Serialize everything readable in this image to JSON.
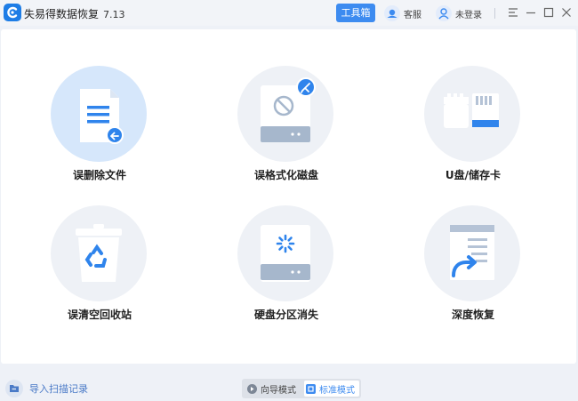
{
  "titlebar": {
    "app_name": "失易得数据恢复",
    "version": "7.13",
    "toolbox_label": "工具箱",
    "service_label": "客服",
    "login_label": "未登录"
  },
  "recovery_options": [
    {
      "label": "误删除文件",
      "icon": "deleted-file-icon"
    },
    {
      "label": "误格式化磁盘",
      "icon": "formatted-disk-icon"
    },
    {
      "label": "U盘/储存卡",
      "icon": "usb-card-icon"
    },
    {
      "label": "误清空回收站",
      "icon": "recycle-bin-icon"
    },
    {
      "label": "硬盘分区消失",
      "icon": "lost-partition-icon"
    },
    {
      "label": "深度恢复",
      "icon": "deep-recovery-icon"
    }
  ],
  "footer": {
    "import_label": "导入扫描记录",
    "guide_mode_label": "向导模式",
    "standard_mode_label": "标准模式",
    "active_mode": "标准模式"
  },
  "colors": {
    "accent": "#3d8bf0",
    "page_bg": "#eef1f7",
    "selected_tile": "#d6e7fb"
  }
}
